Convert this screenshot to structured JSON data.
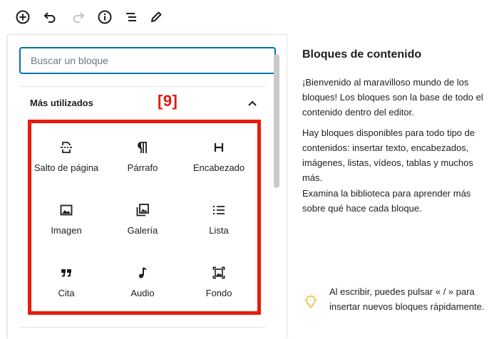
{
  "toolbar": {
    "icons": [
      "add-block-icon",
      "undo-icon",
      "redo-icon",
      "info-icon",
      "list-view-icon",
      "edit-icon"
    ]
  },
  "inserter": {
    "search_placeholder": "Buscar un bloque",
    "section_title": "Más utilizados",
    "annotation": "[9]",
    "blocks": [
      {
        "label": "Salto de página",
        "icon": "page-break-icon"
      },
      {
        "label": "Párrafo",
        "icon": "paragraph-icon"
      },
      {
        "label": "Encabezado",
        "icon": "heading-icon"
      },
      {
        "label": "Imagen",
        "icon": "image-icon"
      },
      {
        "label": "Galería",
        "icon": "gallery-icon"
      },
      {
        "label": "Lista",
        "icon": "list-icon"
      },
      {
        "label": "Cita",
        "icon": "quote-icon"
      },
      {
        "label": "Audio",
        "icon": "audio-icon"
      },
      {
        "label": "Fondo",
        "icon": "cover-icon"
      }
    ]
  },
  "info_panel": {
    "title": "Bloques de contenido",
    "paragraphs": [
      "¡Bienvenido al maravilloso mundo de los bloques! Los bloques son la base de todo el contenido dentro del editor.",
      "Hay bloques disponibles para todo tipo de contenidos: insertar texto, encabezados, imágenes, listas, vídeos, tablas y muchos más.",
      "Examina la biblioteca para aprender más sobre qué hace cada bloque."
    ],
    "tip": "Al escribir, puedes pulsar « / » para insertar nuevos bloques rápidamente."
  },
  "colors": {
    "accent": "#0073aa",
    "highlight": "#e81c0e",
    "tip_icon": "#f0b849"
  }
}
